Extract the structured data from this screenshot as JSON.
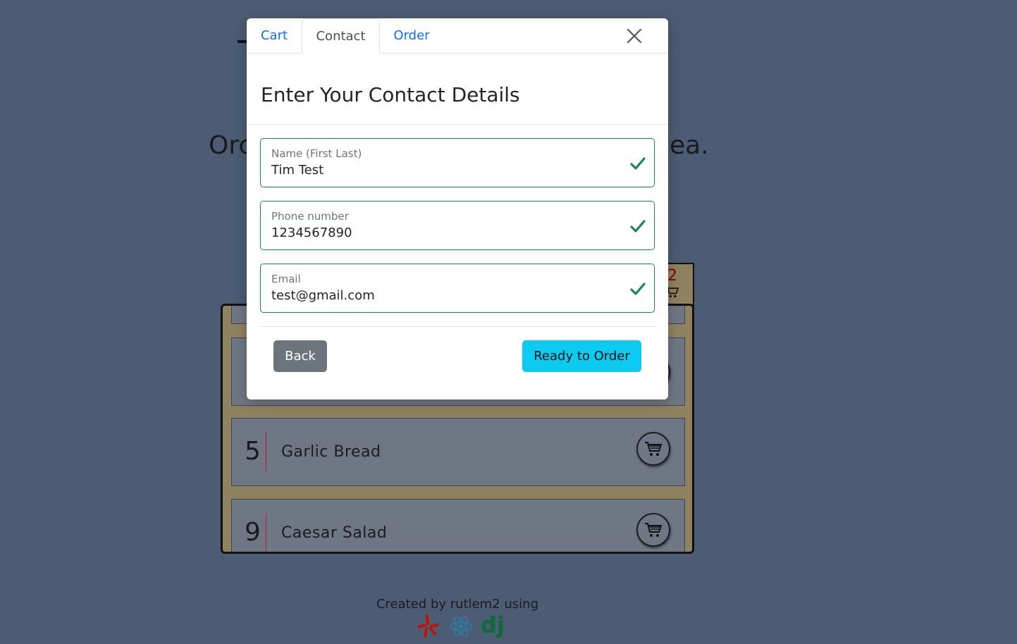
{
  "background": {
    "headline_left": "Orc",
    "headline_right": "ea.",
    "cart_count": "2",
    "menu_items": [
      {
        "number": "5",
        "name": "Garlic Bread"
      },
      {
        "number": "9",
        "name": "Caesar Salad"
      }
    ],
    "footer_text": "Created by rutlem2 using",
    "footer_icons": [
      "yelp-icon",
      "react-icon",
      "django-icon"
    ]
  },
  "modal": {
    "tabs": [
      {
        "label": "Cart",
        "active": false
      },
      {
        "label": "Contact",
        "active": true
      },
      {
        "label": "Order",
        "active": false
      }
    ],
    "title": "Enter Your Contact Details",
    "fields": {
      "name": {
        "label": "Name (First Last)",
        "value": "Tim Test",
        "valid": true
      },
      "phone": {
        "label": "Phone number",
        "value": "1234567890",
        "valid": true
      },
      "email": {
        "label": "Email",
        "value": "test@gmail.com",
        "valid": true
      }
    },
    "back_label": "Back",
    "order_label": "Ready to Order"
  },
  "colors": {
    "page_bg": "#4b5c74",
    "valid": "#198754",
    "primary_link": "#0d6efd",
    "secondary_btn": "#6c757d",
    "info_btn": "#0dcaf0"
  }
}
